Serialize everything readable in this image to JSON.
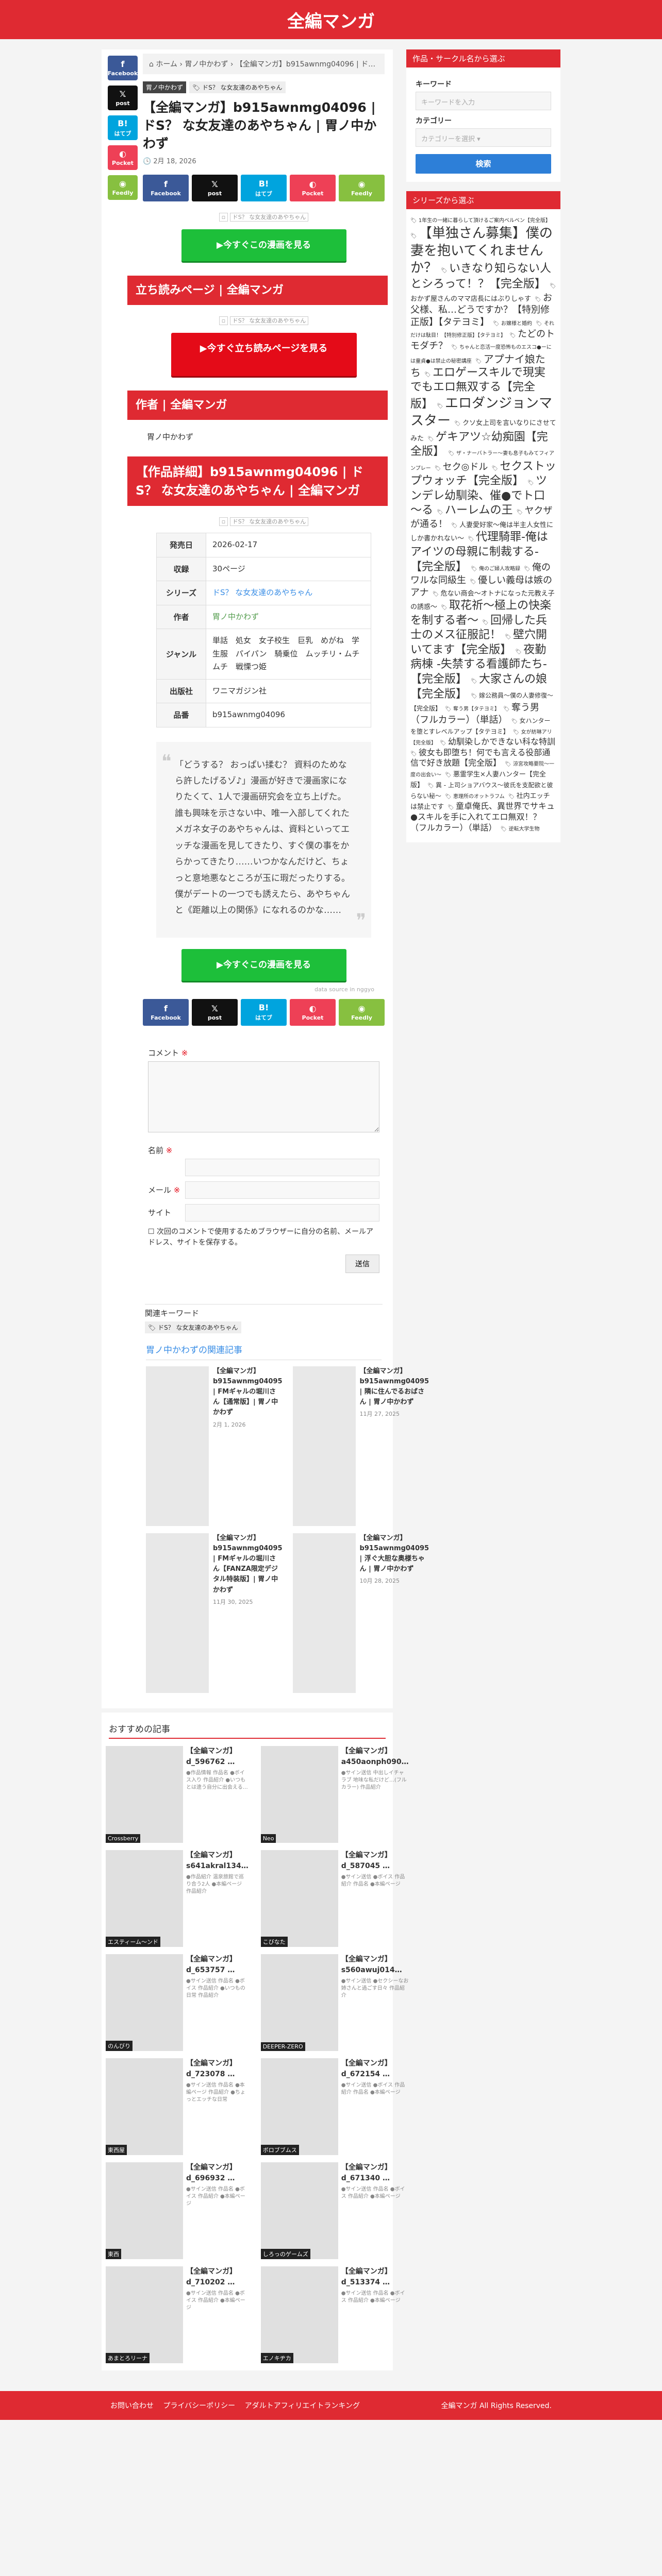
{
  "site": {
    "title": "全編マンガ"
  },
  "breadcrumb": {
    "home": "ホーム",
    "items": [
      "胃ノ中かわず"
    ],
    "current": "【全編マンガ】b915awnmg04096 | ドS？ な女友達のあやちゃん | 胃ノ中かわず"
  },
  "share_vertical": [
    {
      "label": "Facebook",
      "icon": "f"
    },
    {
      "label": "post",
      "icon": "𝕏"
    },
    {
      "label": "はてブ",
      "icon": "B!"
    },
    {
      "label": "Pocket",
      "icon": "◐"
    },
    {
      "label": "Feedly",
      "icon": "◉"
    }
  ],
  "post": {
    "category": "胃ノ中かわず",
    "tag": "ドS？ な女友達のあやちゃん",
    "title": "【全編マンガ】b915awnmg04096 | ドS？ な女友達のあやちゃん | 胃ノ中かわず",
    "date": "2月 18, 2026",
    "share": [
      {
        "label": "Facebook",
        "icon": "f"
      },
      {
        "label": "post",
        "icon": "𝕏"
      },
      {
        "label": "はてブ",
        "icon": "B!"
      },
      {
        "label": "Pocket",
        "icon": "◐"
      },
      {
        "label": "Feedly",
        "icon": "◉"
      }
    ],
    "broken_img_alt": "ドS？ な女友達のあやちゃん",
    "cta_read": "▶今すぐこの漫画を見る",
    "section_preview": "立ち読みページ | 全編マンガ",
    "cta_preview": "▶今すぐ立ち読みページを見る",
    "section_author": "作者 | 全編マンガ",
    "author": "胃ノ中かわず",
    "section_detail": "【作品詳細】b915awnmg04096 | ドS？ な女友達のあやちゃん | 全編マンガ",
    "info": {
      "release_h": "発売日",
      "release": "2026-02-17",
      "pages_h": "収録",
      "pages": "30ページ",
      "series_h": "シリーズ",
      "series": "ドS？ な女友達のあやちゃん",
      "author_h": "作者",
      "author": "胃ノ中かわず",
      "genre_h": "ジャンル",
      "genre": "単話　処女　女子校生　巨乳　めがね　学生服　パイパン　騎乗位　ムッチリ・ムチムチ　戦慄つ姫",
      "publisher_h": "出版社",
      "publisher": "ワニマガジン社",
      "code_h": "品番",
      "code": "b915awnmg04096"
    },
    "synopsis": "「どうする？ おっぱい揉む？ 資料のためなら許したげるゾ♪」漫画が好きで漫画家になりたくて、1人で漫画研究会を立ち上げた。誰も興味を示さない中、唯一入部してくれたメガネ女子のあやちゃんは、資料といってエッチな漫画を見してきたり、すぐ僕の事をからかってきたり……いつかなんだけど、ちょっと意地悪なところが玉に瑕だったりする。僕がデートの一つでも誘えたら、あやちゃんと《距離以上の関係》になれるのかな……",
    "ad_note": "data source in nggyo"
  },
  "comment": {
    "heading": "コメント",
    "name": "名前",
    "email": "メール",
    "site": "サイト",
    "checkbox": "次回のコメントで使用するためブラウザーに自分の名前、メールアドレス、サイトを保存する。",
    "submit": "送信"
  },
  "keywords": {
    "heading": "関連キーワード",
    "tag": "ドS？ な女友達のあやちゃん"
  },
  "related": {
    "heading": "胃ノ中かわずの関連記事",
    "items": [
      {
        "title": "【全編マンガ】b915awnmg04095 | FMギャルの堀川さん【通常版】| 胃ノ中かわず",
        "date": "2月 1, 2026"
      },
      {
        "title": "【全編マンガ】b915awnmg04095 | 隣に住んでるおばさん | 胃ノ中かわず",
        "date": "11月 27, 2025"
      },
      {
        "title": "【全編マンガ】b915awnmg04095 | FMギャルの堀川さん【FANZA限定デジタル特装版】| 胃ノ中かわず",
        "date": "11月 30, 2025"
      },
      {
        "title": "【全編マンガ】b915awnmg04095 | 浮ぐ大胆な奥様ちゃん | 胃ノ中かわず",
        "date": "10月 28, 2025"
      }
    ]
  },
  "recommended": {
    "heading": "おすすめの記事",
    "items": [
      {
        "title": "【全編マンガ】d_596762 …",
        "excerpt": "●作品情報 作品名 ●ボイス入り 作品紹介 ●いつもとは違う自分に出会える…",
        "label": "Crossberry"
      },
      {
        "title": "【全編マンガ】a450aonph090…",
        "excerpt": "●サイン送信 中出しイチャラブ 地味な私だけど…(フルカラー) 作品紹介",
        "label": "Neo"
      },
      {
        "title": "【全編マンガ】s641akral134…",
        "excerpt": "●作品紹介 温泉旅館で巡り合う2人 ●本編ページ 作品紹介",
        "label": "エスティーム～ンド"
      },
      {
        "title": "【全編マンガ】d_587045 …",
        "excerpt": "●サイン送信 ●ボイス 作品紹介 作品名 ●本編ページ",
        "label": "こびなた"
      },
      {
        "title": "【全編マンガ】d_653757 …",
        "excerpt": "●サイン送信 作品名 ●ボイス 作品紹介 ●いつもの日常 作品紹介",
        "label": "のんびり"
      },
      {
        "title": "【全編マンガ】s560awuj014…",
        "excerpt": "●サイン送信 ●セクシーなお姉さんと過ごす日々 作品紹介",
        "label": "DEEPER-ZERO"
      },
      {
        "title": "【全編マンガ】d_723078 …",
        "excerpt": "●サイン送信 作品名 ●本編ページ 作品紹介 ●ちょっとエッチな日常",
        "label": "東西屋"
      },
      {
        "title": "【全編マンガ】d_672154 …",
        "excerpt": "●サイン送信 ●ボイス 作品紹介 作品名 ●本編ページ",
        "label": "ボロブブムス"
      },
      {
        "title": "【全編マンガ】d_696932 …",
        "excerpt": "●サイン送信 作品名 ●ボイス 作品紹介 ●本編ページ",
        "label": "東西"
      },
      {
        "title": "【全編マンガ】d_671340 …",
        "excerpt": "●サイン送信 作品名 ●ボイス 作品紹介 ●本編ページ",
        "label": "しろっのゲームズ"
      },
      {
        "title": "【全編マンガ】d_710202 …",
        "excerpt": "●サイン送信 作品名 ●ボイス 作品紹介 ●本編ページ",
        "label": "あまとろリーナ"
      },
      {
        "title": "【全編マンガ】d_513374 …",
        "excerpt": "●サイン送信 作品名 ●ボイス 作品紹介 ●本編ページ",
        "label": "エノキヂカ"
      }
    ]
  },
  "sidebar": {
    "search_heading": "作品・サークル名から選ぶ",
    "keyword_label": "キーワード",
    "keyword_placeholder": "キーワードを入力",
    "category_label": "カテゴリー",
    "category_value": "カテゴリーを選択",
    "search_button": "検索",
    "series_heading": "シリーズから選ぶ",
    "tags": [
      {
        "t": "1年生の一緒に暮らして頂けるご案内ベルベン【完全版】",
        "s": 10
      },
      {
        "t": "【単独さん募集】僕の妻を抱いてくれませんか？",
        "s": 26
      },
      {
        "t": "いきなり知らない人とシろって！？【完全版】",
        "s": 22
      },
      {
        "t": "おかず屋さんのママ店長にはぶりしゃす",
        "s": 13
      },
      {
        "t": "お父様、私…どうですか？【特別修正版】【タテヨミ】",
        "s": 18
      },
      {
        "t": "お嬢様と婚約",
        "s": 10
      },
      {
        "t": "それだけは駄目！【特別修正版】【タテヨミ】",
        "s": 10
      },
      {
        "t": "たどのトモダチ？",
        "s": 18
      },
      {
        "t": "ちゃんと恋活一度恐怖ものエスコ●ーには童貞●は禁止の秘密講座",
        "s": 10
      },
      {
        "t": "アプナイ娘たち",
        "s": 20
      },
      {
        "t": "エロゲースキルで現実でもエロ無双する【完全版】",
        "s": 22
      },
      {
        "t": "エロダンジョンマスター",
        "s": 26
      },
      {
        "t": "クソ女上司を言いなりにさせてみた",
        "s": 13
      },
      {
        "t": "ゲキアツ☆幼痴園【完全版】",
        "s": 22
      },
      {
        "t": "ザ・ナーバトラー～妻も息子もみてフィアンプレー",
        "s": 10
      },
      {
        "t": "セク◎ドル",
        "s": 18
      },
      {
        "t": "セクストップウォッチ【完全版】",
        "s": 22
      },
      {
        "t": "ツンデレ幼馴染、催●でト口～る",
        "s": 22
      },
      {
        "t": "ハーレムの王",
        "s": 22
      },
      {
        "t": "ヤクザが通る！",
        "s": 18
      },
      {
        "t": "人妻愛好家～俺は半主人女性にしか書かれない～",
        "s": 13
      },
      {
        "t": "代理騎罪-俺はアイツの母親に制裁する-【完全版】",
        "s": 22
      },
      {
        "t": "俺のご婦人攻略録",
        "s": 10
      },
      {
        "t": "俺のワルな同級生",
        "s": 18
      },
      {
        "t": "優しい義母は嫉のアナ",
        "s": 18
      },
      {
        "t": "危ない商会～オトナになった元教え子の誘惑～",
        "s": 13
      },
      {
        "t": "取花祈～極上の快楽を制する者～",
        "s": 22
      },
      {
        "t": "回帰した兵士のメス征服記！",
        "s": 22
      },
      {
        "t": "壁穴開いてます【完全版】",
        "s": 22
      },
      {
        "t": "夜勤病棟 -失禁する看護師たち-【完全版】",
        "s": 22
      },
      {
        "t": "大家さんの娘【完全版】",
        "s": 22
      },
      {
        "t": "嫁公務員～僕の人妻修復～【完全版】",
        "s": 12
      },
      {
        "t": "奪う男【タテヨミ】",
        "s": 10
      },
      {
        "t": "奪う男（フルカラー）（単話）",
        "s": 18
      },
      {
        "t": "女ハンターを堕とすレベルアップ【タテヨミ】",
        "s": 12
      },
      {
        "t": "女が紡琳アリ【完全版】",
        "s": 10
      },
      {
        "t": "幼馴染しかできない科な特訓",
        "s": 16
      },
      {
        "t": "彼女も即堕ち！何でも言える役部通信で好き放題【完全版】",
        "s": 16
      },
      {
        "t": "涼宮攻略要院～一度の出会い～",
        "s": 10
      },
      {
        "t": "悪霊学生×人妻ハンター【完全版】",
        "s": 13
      },
      {
        "t": "異 - 上司ショアバウス～彼氏を支配欲と彼らない秘～",
        "s": 12
      },
      {
        "t": "恵理所のオットラフム",
        "s": 10
      },
      {
        "t": "社内エッチは禁止です",
        "s": 13
      },
      {
        "t": "童卓俺氏、異世界でサキュ●スキルを手に入れてエロ無双！？（フルカラー）（単話）",
        "s": 16
      },
      {
        "t": "逆転大学生物",
        "s": 10
      }
    ]
  },
  "footer": {
    "links": [
      "お問い合わせ",
      "プライバシーポリシー",
      "アダルトアフィリエイトランキング"
    ],
    "copyright": "全編マンガ All Rights Reserved."
  }
}
